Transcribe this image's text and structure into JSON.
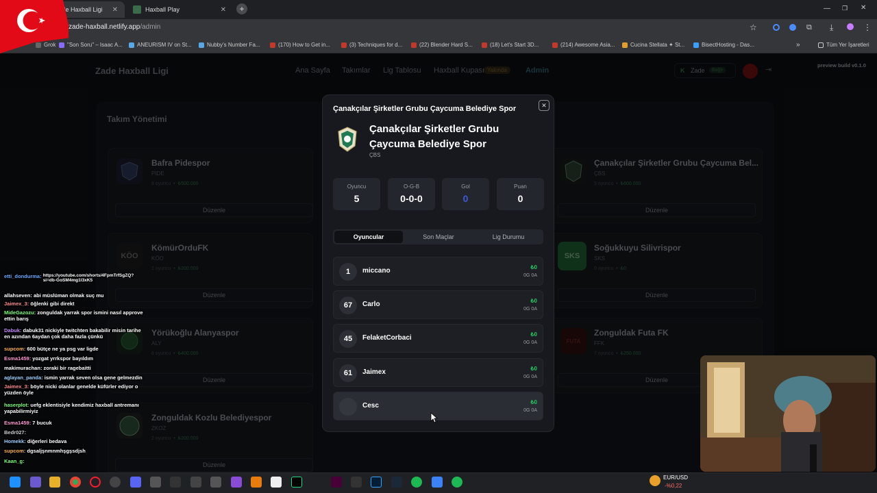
{
  "browser": {
    "tabs": [
      {
        "title": "Zade Haxball Ligi"
      },
      {
        "title": "Haxball Play"
      }
    ],
    "url_host": "zade-haxball.netlify.app",
    "url_path": "/admin",
    "bookmarks": [
      "Grok",
      "\"Son Soru\" – Isaac A...",
      "ANEURISM IV on St...",
      "Nubby's Number Fa...",
      "(170) How to Get in...",
      "(3) Techniques for d...",
      "(22) Blender Hard S...",
      "(18) Let's Start 3D...",
      "(214) Awesome Asia...",
      "Cucina Stellata ✦ St...",
      "BisectHosting - Das..."
    ],
    "all_bookmarks": "Tüm Yer İşaretleri"
  },
  "site": {
    "brand": "Zade Haxball Ligi",
    "nav": [
      "Ana Sayfa",
      "Takımlar",
      "Lig Tablosu",
      "Haxball Kupası",
      "Admin"
    ],
    "cup_badge": "Yakında",
    "user": "Zade",
    "user_badge": "Bağlı",
    "build": "preview build v0.1.0"
  },
  "management": {
    "title": "Takım Yönetimi",
    "edit_label": "Düzenle",
    "teams": [
      {
        "name": "Bafra Pidespor",
        "abbr": "PIDE",
        "players": "8 oyuncu",
        "budget": "₺500.000"
      },
      {
        "name": "Çanakçılar Şirketler Grubu Çaycuma Bel...",
        "abbr": "ÇBS",
        "players": "5 oyuncu",
        "budget": "₺600.000"
      },
      {
        "name": "KömürOrduFK",
        "abbr": "KÖO",
        "players": "1 oyuncu",
        "budget": "₺200.000",
        "logo_text": "KÖO"
      },
      {
        "name": "Soğukkuyu Silivrispor",
        "abbr": "SKS",
        "players": "0 oyuncu",
        "budget": "₺0",
        "logo_text": "SKS"
      },
      {
        "name": "Yörükoğlu Alanyaspor",
        "abbr": "ALY",
        "players": "6 oyuncu",
        "budget": "₺400.000"
      },
      {
        "name": "Zonguldak Futa FK",
        "abbr": "FFK",
        "players": "7 oyuncu",
        "budget": "₺250.000",
        "logo_text": "FUTA"
      },
      {
        "name": "Zonguldak Kozlu Belediyespor",
        "abbr": "ZKOZ",
        "players": "2 oyuncu",
        "budget": "₺200.000"
      }
    ]
  },
  "modal": {
    "header": "Çanakçılar Şirketler Grubu Çaycuma Belediye Spor",
    "name_line1": "Çanakçılar Şirketler Grubu",
    "name_line2": "Çaycuma Belediye Spor",
    "abbr": "ÇBS",
    "stats": [
      {
        "label": "Oyuncu",
        "value": "5"
      },
      {
        "label": "O-G-B",
        "value": "0-0-0"
      },
      {
        "label": "Gol",
        "value": "0"
      },
      {
        "label": "Puan",
        "value": "0"
      }
    ],
    "tabs": [
      "Oyuncular",
      "Son Maçlar",
      "Lig Durumu"
    ],
    "players": [
      {
        "number": "1",
        "name": "miccano",
        "money": "₺0",
        "record": "0G 0A"
      },
      {
        "number": "67",
        "name": "Carlo",
        "money": "₺0",
        "record": "0G 0A"
      },
      {
        "number": "45",
        "name": "FelaketCorbaci",
        "money": "₺0",
        "record": "0G 0A"
      },
      {
        "number": "61",
        "name": "Jaimex",
        "money": "₺0",
        "record": "0G 0A"
      },
      {
        "number": "",
        "name": "Cesc",
        "money": "₺0",
        "record": "0G 0A"
      }
    ]
  },
  "chat": [
    {
      "user": "etti_dondurma:",
      "msg": "https://youtube.com/shorts/4FpmTrfSgZQ?si=db-GoSM4mg1l3xK5",
      "color": "#6aa9ff"
    },
    {
      "user": "allahseven:",
      "msg": "abi müslüman olmak suç mu",
      "color": "#ffffff"
    },
    {
      "user": "Jaimex_3:",
      "msg": "öğlenki gibi direkt",
      "color": "#ff8c8c"
    },
    {
      "user": "MideGazozu:",
      "msg": "zonguldak yarrak spor ismini nasıl approve ettin barış",
      "color": "#7dff7d"
    },
    {
      "user": "Dabuk:",
      "msg": "dabuk31 nickiyle twitchten bakabilir misin tarihe en azından 6aydan çok daha fazla çünkü",
      "color": "#c58cff"
    },
    {
      "user": "supcom:",
      "msg": "600 bütçe ne ya psg var ligde",
      "color": "#ffb347"
    },
    {
      "user": "Esma1459:",
      "msg": "yozgat yrrkspor bayıldım",
      "color": "#ff9ad5"
    },
    {
      "user": "makimurachan:",
      "msg": "zoraki bir ragebaitti",
      "color": "#ffffff"
    },
    {
      "user": "aglayan_panda:",
      "msg": "ismin yarrak seven olsa gene gelmezdin",
      "color": "#9ad0ff"
    },
    {
      "user": "Jaimex_3:",
      "msg": "böyle nicki olanlar genelde küfürler ediyor o yüzden öyle",
      "color": "#ff8c8c"
    },
    {
      "user": "haserplot:",
      "msg": "uefg eklentisiyle kendimiz haxball antremanı yapabilirmiyiz",
      "color": "#7dff7d"
    },
    {
      "user": "Esma1459:",
      "msg": "7 bucuk",
      "color": "#ff9ad5"
    },
    {
      "user": "Bedr027:",
      "msg": "",
      "color": "#cccccc"
    },
    {
      "user": "Homekk:",
      "msg": "diğerleri bedava",
      "color": "#9ad0ff"
    },
    {
      "user": "supcom:",
      "msg": "dgsaljşnmnmhşgşsdjsh",
      "color": "#ffb347"
    },
    {
      "user": "Kaan_g:",
      "msg": "",
      "color": "#7dff7d"
    }
  ],
  "taskbar": {
    "ticker": "EUR/USD",
    "change": "-%0,22"
  }
}
